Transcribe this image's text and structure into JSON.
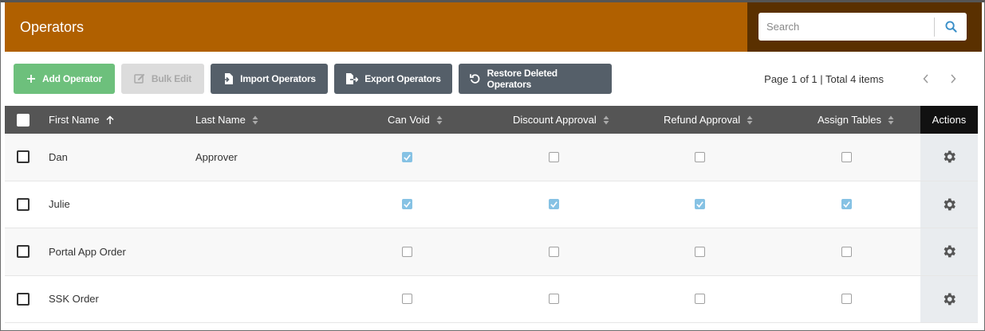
{
  "header": {
    "title": "Operators"
  },
  "search": {
    "placeholder": "Search"
  },
  "toolbar": {
    "add_label": "Add Operator",
    "bulk_label": "Bulk Edit",
    "import_label": "Import Operators",
    "export_label": "Export Operators",
    "restore_label": "Restore Deleted Operators"
  },
  "pager": {
    "info": "Page 1 of 1 | Total 4 items"
  },
  "table": {
    "columns": {
      "first_name": "First Name",
      "last_name": "Last Name",
      "can_void": "Can Void",
      "discount": "Discount Approval",
      "refund": "Refund Approval",
      "assign": "Assign Tables",
      "actions": "Actions"
    },
    "rows": [
      {
        "first_name": "Dan",
        "last_name": "Approver",
        "can_void": true,
        "discount": false,
        "refund": false,
        "assign": false
      },
      {
        "first_name": "Julie",
        "last_name": "",
        "can_void": true,
        "discount": true,
        "refund": true,
        "assign": true
      },
      {
        "first_name": "Portal App Order",
        "last_name": "",
        "can_void": false,
        "discount": false,
        "refund": false,
        "assign": false
      },
      {
        "first_name": "SSK Order",
        "last_name": "",
        "can_void": false,
        "discount": false,
        "refund": false,
        "assign": false
      }
    ]
  },
  "colors": {
    "header_bg": "#b06000",
    "search_area_bg": "#5a3000",
    "add_button": "#6dc07c",
    "dark_button": "#555f69",
    "table_header": "#555555",
    "checked": "#86c2e4"
  }
}
